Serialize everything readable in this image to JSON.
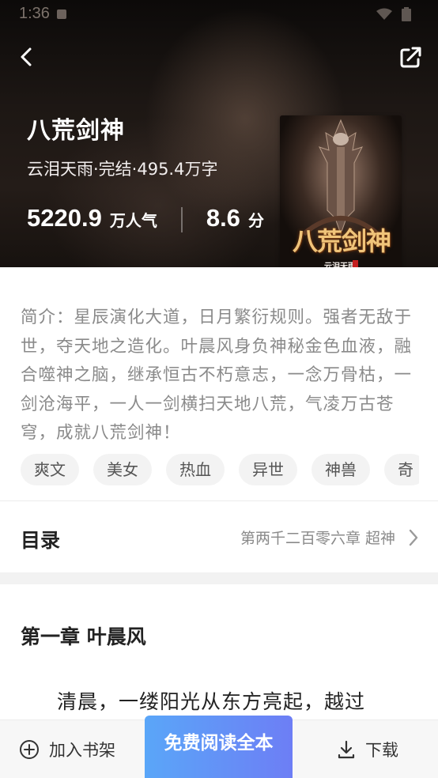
{
  "status_bar": {
    "time": "1:36"
  },
  "book": {
    "title": "八荒剑神",
    "meta": "云泪天雨·完结·495.4万字",
    "popularity_value": "5220.9",
    "popularity_unit": "万人气",
    "score_value": "8.6",
    "score_unit": "分",
    "cover_title": "八荒剑神",
    "cover_author": "云泪天雨"
  },
  "intro": {
    "text": "简介：星辰演化大道，日月繁衍规则。强者无敌于世，夺天地之造化。叶晨风身负神秘金色血液，融合噬神之脑，继承恒古不朽意志，一念万骨枯，一剑沧海平，一人一剑横扫天地八荒，气凌万古苍穹，成就八荒剑神！"
  },
  "tags": [
    "爽文",
    "美女",
    "热血",
    "异世",
    "神兽",
    "奇"
  ],
  "toc": {
    "label": "目录",
    "latest_chapter": "第两千二百零六章 超神"
  },
  "chapter": {
    "title": "第一章 叶晨风",
    "first_line": "清晨，一缕阳光从东方亮起，越过"
  },
  "bottom_bar": {
    "add_shelf": "加入书架",
    "read_free": "免费阅读全本",
    "download": "下载"
  },
  "icons": {
    "back": "chevron-left-icon",
    "share": "share-icon",
    "add": "plus-circle-icon",
    "download": "download-icon",
    "toc": "chevron-right-icon"
  },
  "colors": {
    "accent_start": "#5aa6f8",
    "accent_end": "#6d7ef5",
    "header_bg": "#1d1714"
  }
}
